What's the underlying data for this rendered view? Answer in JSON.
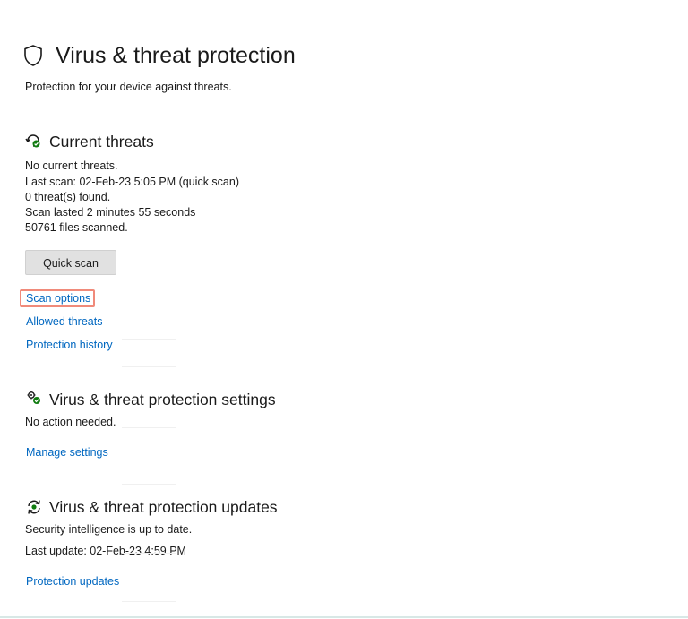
{
  "header": {
    "title": "Virus & threat protection",
    "subtitle": "Protection for your device against threats.",
    "icon": "shield-icon"
  },
  "current_threats": {
    "heading": "Current threats",
    "icon": "threat-refresh-icon",
    "lines": [
      "No current threats.",
      "Last scan: 02-Feb-23 5:05 PM (quick scan)",
      "0 threat(s) found.",
      "Scan lasted 2 minutes 55 seconds",
      "50761 files scanned."
    ],
    "quick_scan_label": "Quick scan",
    "links": {
      "scan_options": "Scan options",
      "allowed_threats": "Allowed threats",
      "protection_history": "Protection history"
    }
  },
  "settings": {
    "heading": "Virus & threat protection settings",
    "icon": "settings-gears-icon",
    "status": "No action needed.",
    "manage_link": "Manage settings"
  },
  "updates": {
    "heading": "Virus & threat protection updates",
    "icon": "update-refresh-icon",
    "status": "Security intelligence is up to date.",
    "last_update": "Last update: 02-Feb-23 4:59 PM",
    "updates_link": "Protection updates"
  },
  "colors": {
    "link": "#0067c0",
    "button_bg": "#e1e1e1",
    "highlight": "#f08a7a",
    "status_green": "#107c10"
  }
}
